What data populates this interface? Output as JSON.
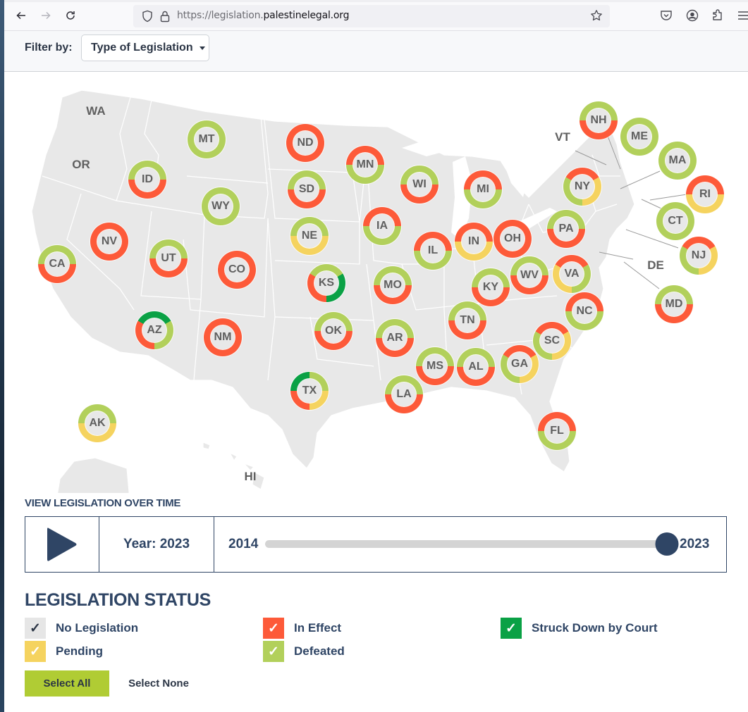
{
  "browser": {
    "url_prefix": "https://legislation.",
    "url_domain": "palestinelegal.org",
    "icons": [
      "back-arrow-icon",
      "forward-arrow-icon",
      "reload-icon",
      "shield-icon",
      "lock-icon",
      "star-icon",
      "pocket-icon",
      "account-icon",
      "extensions-icon",
      "menu-icon"
    ]
  },
  "filter": {
    "label": "Filter by:",
    "dropdown_label": "Type of Legislation"
  },
  "colors": {
    "no_legislation": "#e6e6e6",
    "pending": "#f5d35f",
    "in_effect": "#fd5a39",
    "defeated": "#b2d05b",
    "struck_down": "#0aa145",
    "navy": "#2f4565",
    "map_fill": "#e8e8e8"
  },
  "map": {
    "plain_labels": [
      {
        "abbr": "WA"
      },
      {
        "abbr": "OR"
      },
      {
        "abbr": "VT"
      },
      {
        "abbr": "DE"
      },
      {
        "abbr": "HI"
      }
    ],
    "states": [
      {
        "abbr": "MT",
        "segments": [
          [
            "defeated",
            1
          ]
        ]
      },
      {
        "abbr": "ID",
        "segments": [
          [
            "defeated",
            0.5
          ],
          [
            "in_effect",
            0.5
          ]
        ]
      },
      {
        "abbr": "WY",
        "segments": [
          [
            "defeated",
            1
          ]
        ]
      },
      {
        "abbr": "NV",
        "segments": [
          [
            "in_effect",
            1
          ]
        ]
      },
      {
        "abbr": "UT",
        "segments": [
          [
            "defeated",
            0.5
          ],
          [
            "in_effect",
            0.5
          ]
        ]
      },
      {
        "abbr": "CA",
        "segments": [
          [
            "defeated",
            0.5
          ],
          [
            "in_effect",
            0.5
          ]
        ]
      },
      {
        "abbr": "CO",
        "segments": [
          [
            "in_effect",
            1
          ]
        ]
      },
      {
        "abbr": "AZ",
        "segments": [
          [
            "struck_down",
            0.333
          ],
          [
            "defeated",
            0.333
          ],
          [
            "in_effect",
            0.334
          ]
        ],
        "start": -60
      },
      {
        "abbr": "NM",
        "segments": [
          [
            "in_effect",
            1
          ]
        ]
      },
      {
        "abbr": "ND",
        "segments": [
          [
            "in_effect",
            1
          ]
        ]
      },
      {
        "abbr": "SD",
        "segments": [
          [
            "defeated",
            0.5
          ],
          [
            "in_effect",
            0.5
          ]
        ]
      },
      {
        "abbr": "NE",
        "segments": [
          [
            "defeated",
            0.5
          ],
          [
            "pending",
            0.5
          ]
        ]
      },
      {
        "abbr": "KS",
        "segments": [
          [
            "defeated",
            0.333
          ],
          [
            "struck_down",
            0.333
          ],
          [
            "in_effect",
            0.334
          ]
        ],
        "start": -60
      },
      {
        "abbr": "OK",
        "segments": [
          [
            "defeated",
            0.5
          ],
          [
            "in_effect",
            0.5
          ]
        ]
      },
      {
        "abbr": "TX",
        "segments": [
          [
            "struck_down",
            0.25
          ],
          [
            "defeated",
            0.25
          ],
          [
            "pending",
            0.25
          ],
          [
            "in_effect",
            0.25
          ]
        ]
      },
      {
        "abbr": "MN",
        "segments": [
          [
            "in_effect",
            0.5
          ],
          [
            "defeated",
            0.5
          ]
        ],
        "start": -90
      },
      {
        "abbr": "IA",
        "segments": [
          [
            "in_effect",
            0.5
          ],
          [
            "defeated",
            0.5
          ]
        ],
        "start": -90
      },
      {
        "abbr": "MO",
        "segments": [
          [
            "defeated",
            0.5
          ],
          [
            "in_effect",
            0.5
          ]
        ]
      },
      {
        "abbr": "AR",
        "segments": [
          [
            "defeated",
            0.5
          ],
          [
            "in_effect",
            0.5
          ]
        ]
      },
      {
        "abbr": "LA",
        "segments": [
          [
            "defeated",
            0.5
          ],
          [
            "in_effect",
            0.5
          ]
        ]
      },
      {
        "abbr": "WI",
        "segments": [
          [
            "defeated",
            0.5
          ],
          [
            "in_effect",
            0.5
          ]
        ]
      },
      {
        "abbr": "IL",
        "segments": [
          [
            "in_effect",
            0.5
          ],
          [
            "defeated",
            0.5
          ]
        ],
        "start": -90
      },
      {
        "abbr": "MI",
        "segments": [
          [
            "in_effect",
            0.5
          ],
          [
            "defeated",
            0.5
          ]
        ],
        "start": -90
      },
      {
        "abbr": "IN",
        "segments": [
          [
            "in_effect",
            0.5
          ],
          [
            "pending",
            0.5
          ]
        ],
        "start": -90
      },
      {
        "abbr": "OH",
        "segments": [
          [
            "in_effect",
            1
          ]
        ]
      },
      {
        "abbr": "KY",
        "segments": [
          [
            "defeated",
            0.5
          ],
          [
            "in_effect",
            0.5
          ]
        ]
      },
      {
        "abbr": "TN",
        "segments": [
          [
            "defeated",
            0.5
          ],
          [
            "in_effect",
            0.5
          ]
        ]
      },
      {
        "abbr": "MS",
        "segments": [
          [
            "defeated",
            0.5
          ],
          [
            "in_effect",
            0.5
          ]
        ]
      },
      {
        "abbr": "AL",
        "segments": [
          [
            "defeated",
            0.5
          ],
          [
            "in_effect",
            0.5
          ]
        ]
      },
      {
        "abbr": "GA",
        "segments": [
          [
            "in_effect",
            0.333
          ],
          [
            "pending",
            0.333
          ],
          [
            "defeated",
            0.334
          ]
        ],
        "start": -60
      },
      {
        "abbr": "SC",
        "segments": [
          [
            "in_effect",
            0.333
          ],
          [
            "pending",
            0.333
          ],
          [
            "defeated",
            0.334
          ]
        ],
        "start": -60
      },
      {
        "abbr": "NC",
        "segments": [
          [
            "in_effect",
            0.5
          ],
          [
            "defeated",
            0.5
          ]
        ],
        "start": -90
      },
      {
        "abbr": "FL",
        "segments": [
          [
            "in_effect",
            0.5
          ],
          [
            "defeated",
            0.5
          ]
        ],
        "start": -90
      },
      {
        "abbr": "WV",
        "segments": [
          [
            "defeated",
            0.5
          ],
          [
            "in_effect",
            0.5
          ]
        ]
      },
      {
        "abbr": "VA",
        "segments": [
          [
            "in_effect",
            0.333
          ],
          [
            "defeated",
            0.333
          ],
          [
            "pending",
            0.334
          ]
        ],
        "start": -60
      },
      {
        "abbr": "PA",
        "segments": [
          [
            "defeated",
            0.5
          ],
          [
            "in_effect",
            0.5
          ]
        ]
      },
      {
        "abbr": "NY",
        "segments": [
          [
            "in_effect",
            0.333
          ],
          [
            "pending",
            0.333
          ],
          [
            "defeated",
            0.334
          ]
        ],
        "start": -60
      },
      {
        "abbr": "NH",
        "segments": [
          [
            "defeated",
            0.5
          ],
          [
            "in_effect",
            0.5
          ]
        ]
      },
      {
        "abbr": "ME",
        "segments": [
          [
            "defeated",
            1
          ]
        ]
      },
      {
        "abbr": "MA",
        "segments": [
          [
            "defeated",
            1
          ]
        ]
      },
      {
        "abbr": "RI",
        "segments": [
          [
            "in_effect",
            0.5
          ],
          [
            "pending",
            0.5
          ]
        ],
        "start": -90
      },
      {
        "abbr": "CT",
        "segments": [
          [
            "defeated",
            1
          ]
        ]
      },
      {
        "abbr": "NJ",
        "segments": [
          [
            "in_effect",
            0.333
          ],
          [
            "pending",
            0.333
          ],
          [
            "defeated",
            0.334
          ]
        ],
        "start": -60
      },
      {
        "abbr": "MD",
        "segments": [
          [
            "defeated",
            0.5
          ],
          [
            "in_effect",
            0.5
          ]
        ]
      },
      {
        "abbr": "AK",
        "segments": [
          [
            "defeated",
            0.5
          ],
          [
            "pending",
            0.5
          ]
        ]
      }
    ]
  },
  "timeline": {
    "title": "VIEW LEGISLATION OVER TIME",
    "year_label": "Year: 2023",
    "min_year": "2014",
    "max_year": "2023",
    "current_year": 2023,
    "range": [
      2014,
      2023
    ]
  },
  "legend": {
    "title": "LEGISLATION STATUS",
    "items": [
      {
        "key": "no_legislation",
        "label": "No Legislation",
        "checked": true
      },
      {
        "key": "in_effect",
        "label": "In Effect",
        "checked": true
      },
      {
        "key": "struck_down",
        "label": "Struck Down by Court",
        "checked": true
      },
      {
        "key": "pending",
        "label": "Pending",
        "checked": true
      },
      {
        "key": "defeated",
        "label": "Defeated",
        "checked": true
      }
    ],
    "check_glyph": "✓",
    "select_all": "Select All",
    "select_none": "Select None"
  }
}
